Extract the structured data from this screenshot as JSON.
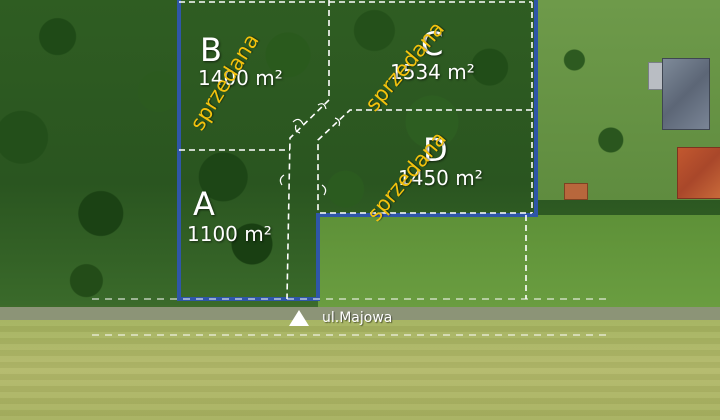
{
  "map": {
    "street": {
      "name": "ul.Majowa",
      "marker_icon": "triangle-marker-icon"
    },
    "plots": [
      {
        "letter": "A",
        "area": "1100 m²",
        "status": ""
      },
      {
        "letter": "B",
        "area": "1400 m²",
        "status": "sprzedana"
      },
      {
        "letter": "C",
        "area": "1534 m²",
        "status": "sprzedana"
      },
      {
        "letter": "D",
        "area": "1450 m²",
        "status": "sprzedana"
      }
    ],
    "colors": {
      "plot_border": "#2f56a8",
      "plot_divider": "#ffffff",
      "sold_text": "#f4c20d",
      "label_text": "#ffffff"
    }
  }
}
